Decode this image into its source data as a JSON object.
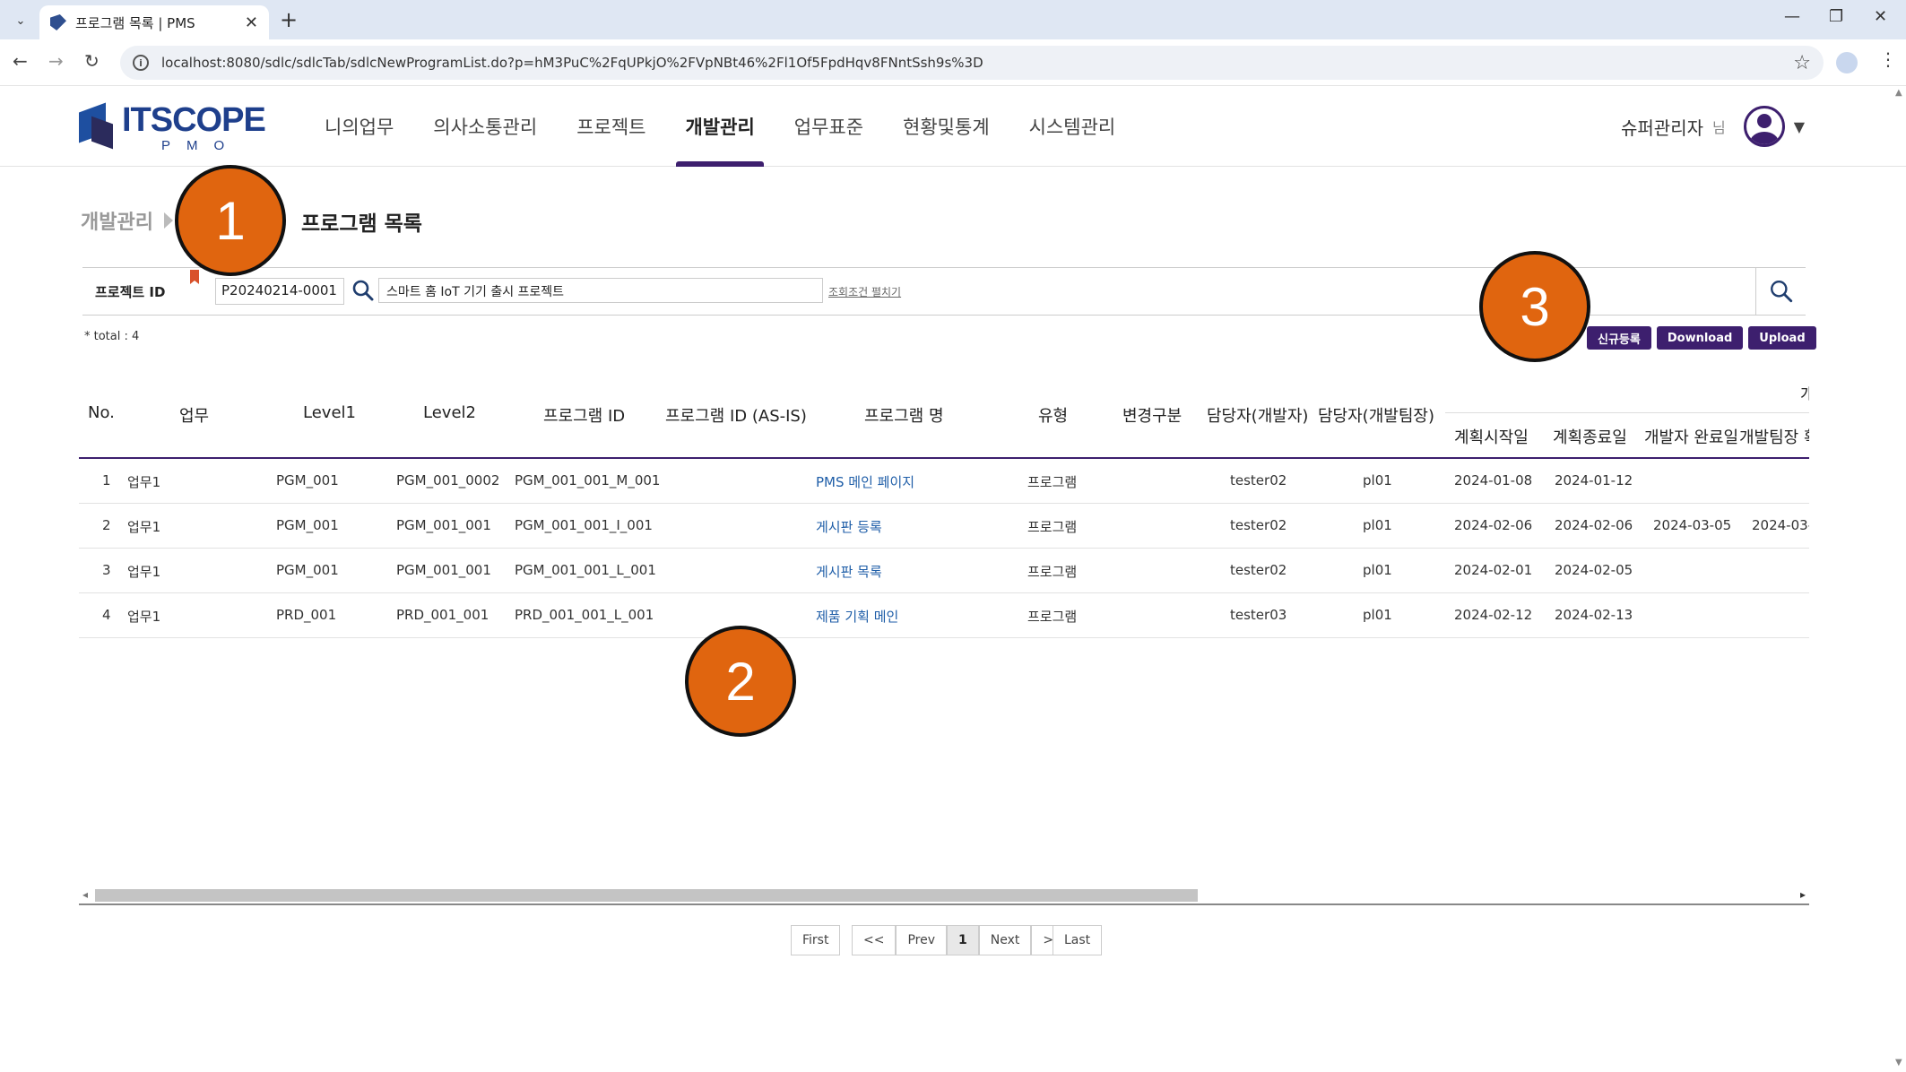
{
  "browser": {
    "tab_title": "프로그램 목록 | PMS",
    "url": "localhost:8080/sdlc/sdlcTab/sdlcNewProgramList.do?p=hM3PuC%2FqUPkjO%2FVpNBt46%2Fl1Of5FpdHqv8FNntSsh9s%3D"
  },
  "logo": {
    "word": "ITSCOPE",
    "sub": "PMO"
  },
  "nav": [
    "니의업무",
    "의사소통관리",
    "프로젝트",
    "개발관리",
    "업무표준",
    "현황및통계",
    "시스템관리"
  ],
  "nav_active": "개발관리",
  "user": {
    "name": "슈퍼관리자",
    "honorific": "님"
  },
  "breadcrumb": {
    "parent": "개발관리"
  },
  "page_title": "프로그램 목록",
  "search": {
    "label": "프로젝트 ID",
    "project_id": "P20240214-0001",
    "project_name": "스마트 홈 IoT 기기 출시 프로젝트",
    "toggle": "조회조건 펼치기"
  },
  "total": "* total : 4",
  "buttons": {
    "new": "신규등록",
    "download": "Download",
    "upload": "Upload"
  },
  "table": {
    "group_header": "개",
    "headers": [
      "No.",
      "업무",
      "Level1",
      "Level2",
      "프로그램 ID",
      "프로그램 ID (AS-IS)",
      "프로그램 명",
      "유형",
      "변경구분",
      "담당자(개발자)",
      "담당자(개발팀장)",
      "계획시작일",
      "계획종료일",
      "개발자 완료일",
      "개발팀장 확"
    ],
    "rows": [
      [
        "1",
        "업무1",
        "PGM_001",
        "PGM_001_0002",
        "PGM_001_001_M_001",
        "",
        "PMS 메인 페이지",
        "프로그램",
        "",
        "tester02",
        "pl01",
        "2024-01-08",
        "2024-01-12",
        "",
        ""
      ],
      [
        "2",
        "업무1",
        "PGM_001",
        "PGM_001_001",
        "PGM_001_001_I_001",
        "",
        "게시판 등록",
        "프로그램",
        "",
        "tester02",
        "pl01",
        "2024-02-06",
        "2024-02-06",
        "2024-03-05",
        "2024-03-"
      ],
      [
        "3",
        "업무1",
        "PGM_001",
        "PGM_001_001",
        "PGM_001_001_L_001",
        "",
        "게시판 목록",
        "프로그램",
        "",
        "tester02",
        "pl01",
        "2024-02-01",
        "2024-02-05",
        "",
        ""
      ],
      [
        "4",
        "업무1",
        "PRD_001",
        "PRD_001_001",
        "PRD_001_001_L_001",
        "",
        "제품 기획 메인",
        "프로그램",
        "",
        "tester03",
        "pl01",
        "2024-02-12",
        "2024-02-13",
        "",
        ""
      ]
    ]
  },
  "pager": {
    "first": "First",
    "prev_sym": "<<",
    "prev": "Prev",
    "current": "1",
    "next": "Next",
    "next_sym": ">>",
    "last": "Last"
  },
  "callouts": [
    "1",
    "2",
    "3"
  ],
  "colors": {
    "accent": "#3d1f6e",
    "callout": "#e0650f",
    "link": "#1f5ea8"
  }
}
